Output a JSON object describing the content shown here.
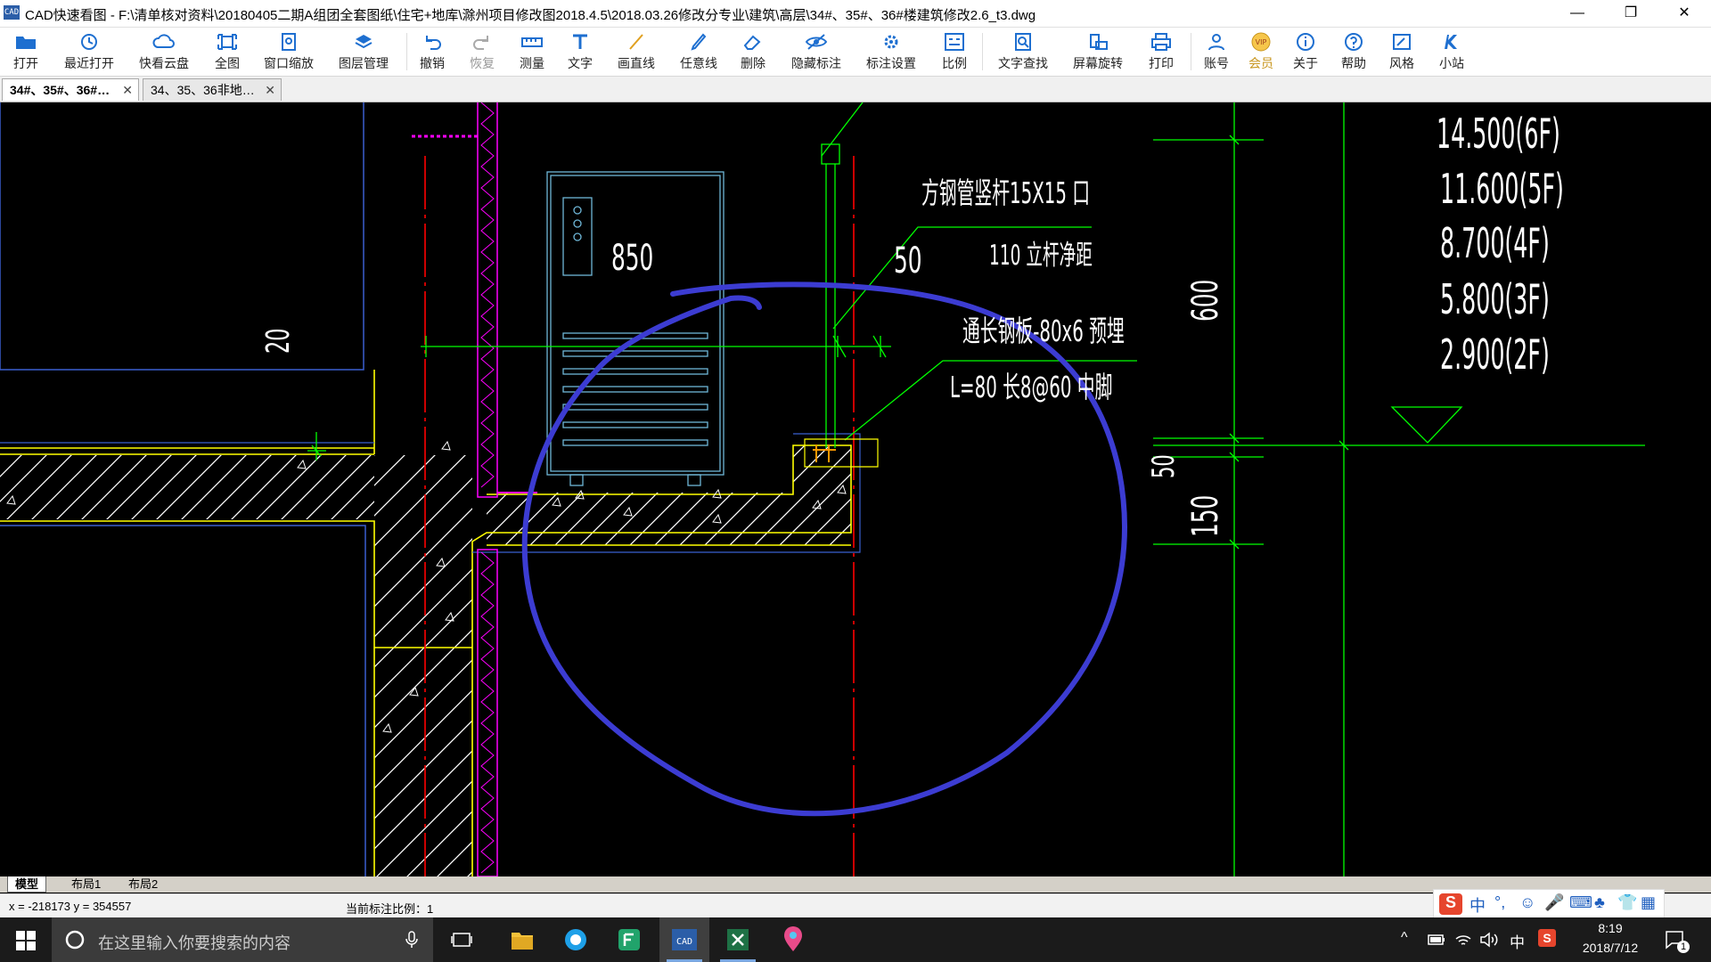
{
  "window": {
    "title": "CAD快速看图 - F:\\清单核对资料\\20180405二期A组团全套图纸\\住宅+地库\\滁州项目修改图2018.4.5\\2018.03.26修改分专业\\建筑\\高层\\34#、35#、36#楼建筑修改2.6_t3.dwg",
    "app_icon_text": "CAD",
    "minimize": "—",
    "restore": "❐",
    "close": "✕"
  },
  "toolbar": {
    "items": [
      {
        "label": "打开",
        "icon": "folder-open-icon"
      },
      {
        "label": "最近打开",
        "icon": "recent-icon"
      },
      {
        "label": "快看云盘",
        "icon": "cloud-icon"
      },
      {
        "label": "全图",
        "icon": "fit-all-icon"
      },
      {
        "label": "窗口缩放",
        "icon": "zoom-window-icon"
      },
      {
        "label": "图层管理",
        "icon": "layers-icon"
      },
      {
        "label": "撤销",
        "icon": "undo-icon"
      },
      {
        "label": "恢复",
        "icon": "redo-icon"
      },
      {
        "label": "测量",
        "icon": "measure-icon"
      },
      {
        "label": "文字",
        "icon": "text-icon"
      },
      {
        "label": "画直线",
        "icon": "line-icon"
      },
      {
        "label": "任意线",
        "icon": "freehand-icon"
      },
      {
        "label": "删除",
        "icon": "eraser-icon"
      },
      {
        "label": "隐藏标注",
        "icon": "hide-annotation-icon"
      },
      {
        "label": "标注设置",
        "icon": "annotation-settings-icon"
      },
      {
        "label": "比例",
        "icon": "scale-icon"
      },
      {
        "label": "文字查找",
        "icon": "text-search-icon"
      },
      {
        "label": "屏幕旋转",
        "icon": "rotate-screen-icon"
      },
      {
        "label": "打印",
        "icon": "print-icon"
      },
      {
        "label": "账号",
        "icon": "account-icon"
      },
      {
        "label": "会员",
        "icon": "vip-icon"
      },
      {
        "label": "关于",
        "icon": "info-icon"
      },
      {
        "label": "帮助",
        "icon": "help-icon"
      },
      {
        "label": "风格",
        "icon": "style-icon"
      },
      {
        "label": "小站",
        "icon": "station-icon"
      }
    ]
  },
  "tabs": [
    {
      "label": "34#、35#、36#…",
      "close": "✕",
      "active": true
    },
    {
      "label": "34、35、36非地…",
      "close": "✕",
      "active": false
    }
  ],
  "drawing": {
    "dims": {
      "d850": "850",
      "d50_top": "50",
      "d20": "20",
      "d600": "600",
      "d50_right": "50",
      "d150": "150"
    },
    "notes": {
      "note1": "方钢管竖杆15X15 口",
      "note2": "110 立杆净距",
      "note3": "通长钢板-80x6 预埋",
      "note4": "L=80 长8@60 中脚"
    },
    "levels": [
      "14.500(6F)",
      "11.600(5F)",
      "8.700(4F)",
      "5.800(3F)",
      "2.900(2F)"
    ]
  },
  "layout_tabs": [
    "模型",
    "布局1",
    "布局2"
  ],
  "status": {
    "coords": "x = -218173 y = 354557",
    "scale": "当前标注比例：1"
  },
  "ime": {
    "chars": [
      "中",
      "°,",
      "☺",
      "🎤",
      "⌨",
      "♣",
      "👕",
      "▦"
    ]
  },
  "taskbar": {
    "search_placeholder": "在这里输入你要搜索的内容",
    "time": "8:19",
    "date": "2018/7/12",
    "ime_indicator": "中",
    "notification_count": "1"
  },
  "colors": {
    "canvas_bg": "#000000",
    "annotation_circle": "#3c3cd2",
    "cad_green": "#00ff00",
    "cad_yellow": "#ffff00",
    "cad_magenta": "#ff00ff",
    "cad_red": "#ff0000",
    "cad_cyan": "#00bcd4",
    "cad_orange": "#ff9900"
  }
}
